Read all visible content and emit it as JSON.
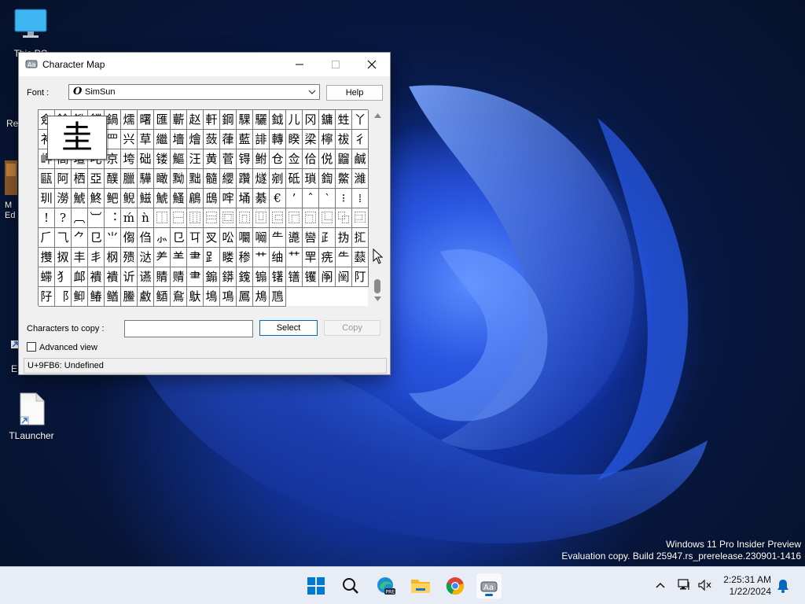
{
  "desktop": {
    "icons": [
      {
        "label": "This PC"
      },
      {
        "label": "Re"
      },
      {
        "label": "M\nEd"
      },
      {
        "label": "E"
      },
      {
        "label": "TLauncher"
      }
    ],
    "watermark": {
      "line1": "Windows 11 Pro Insider Preview",
      "line2": "Evaluation copy. Build 25947.rs_prerelease.230901-1416"
    }
  },
  "window": {
    "title": "Character Map",
    "font_label": "Font :",
    "font_value": "SimSun",
    "help_label": "Help",
    "zoom_char": "圭",
    "grid_rows": [
      "僉餘鍁鐺鍋燸曙匯蘄赵軒鋼騍驪鉞儿冈鏞甡",
      "丫衤罗廾皿罒兴草繼墻燴蔹葎藍誹轉睽梁檸祓伃",
      "彳岬髙壇叱京垮础镂鰸汪黄菅锝鲋仓佥佮侻䶉鰳",
      "鹹甌阿栖亞醭臘驊瞰黝黜髓纓躦燧剜砥瑣鍧鱉",
      "濰玔澇鯱鮗鲃鲵鰦鯱鰠鵳鴟哰埇綦€’ˆ‵",
      "⁝⁞!?︹︺︓ḿǹ⿰⿱⿲⿳⿴⿵⿶⿷⿸⿹⿺",
      "⿻⿼⺁⺄⺈⺋⺌㑳㑇⺗㔾㔿㕚㕬㘚㘎⺧㘏㘘⺪",
      "㧑㧟㩳㧐丰丯㭎㱮㳠⺶⺷⺻⻊䁖䅟⺾䌷⺿䍐㾌",
      "⺧䕭䗖⺨䘏䙡䙡䜣䜩䝼䞍⺻䥇䥈䥉䦂䦃䦅",
      "䦆䦶䦷䦺䦻⻏䲟䲠䲡䲢䲣䲤䲥䲦䲧䲨䲩䲪䲫"
    ],
    "copy_label": "Characters to copy :",
    "copy_value": "",
    "select_label": "Select",
    "copy_button_label": "Copy",
    "advanced_label": "Advanced view",
    "advanced_checked": false,
    "status_text": "U+9FB6: Undefined"
  },
  "taskbar": {
    "time": "2:25:31 AM",
    "date": "1/22/2024",
    "apps": [
      "start-icon",
      "search-icon",
      "edge-preview-icon",
      "file-explorer-icon",
      "chrome-icon",
      "character-map-icon"
    ]
  },
  "colors": {
    "accent": "#0067c0",
    "taskbar": "#e8edf5",
    "wallpaper": "#1e4fd8"
  }
}
